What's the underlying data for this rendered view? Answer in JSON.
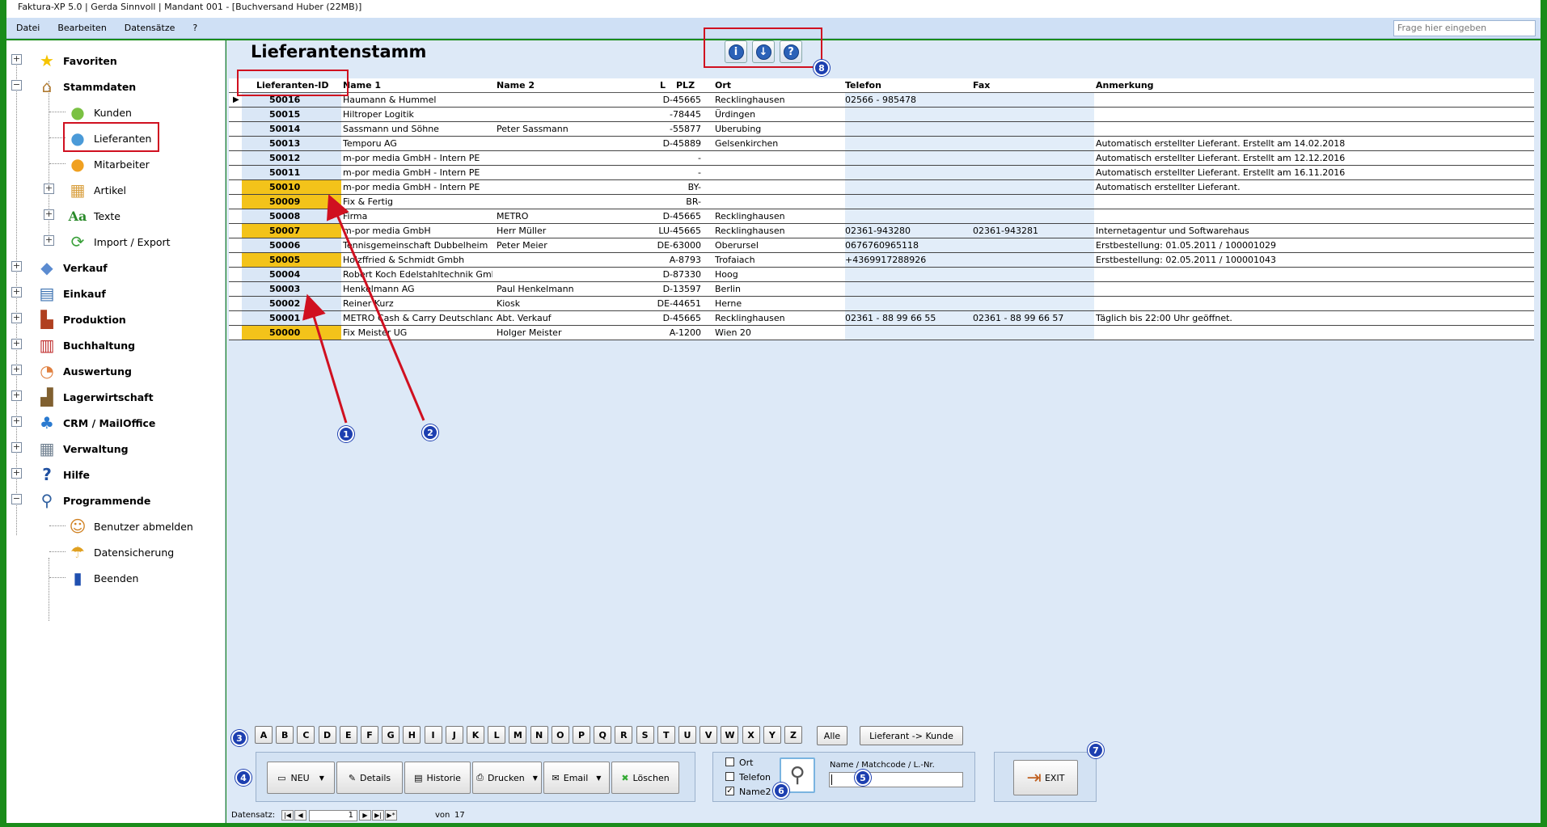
{
  "window": {
    "title": "Faktura-XP 5.0 | Gerda Sinnvoll | Mandant 001 - [Buchversand Huber (22MB)]"
  },
  "menu": {
    "items": [
      "Datei",
      "Bearbeiten",
      "Datensätze",
      "?"
    ],
    "ask_placeholder": "Frage hier eingeben"
  },
  "sidebar": {
    "items": [
      {
        "label": "Favoriten",
        "icon": "star-icon"
      },
      {
        "label": "Stammdaten",
        "icon": "house-icon"
      },
      {
        "label": "Kunden",
        "icon": "person-green-icon"
      },
      {
        "label": "Lieferanten",
        "icon": "person-blue-icon"
      },
      {
        "label": "Mitarbeiter",
        "icon": "person-orange-icon"
      },
      {
        "label": "Artikel",
        "icon": "boxes-icon"
      },
      {
        "label": "Texte",
        "icon": "text-aa-icon"
      },
      {
        "label": "Import / Export",
        "icon": "arrows-cycle-icon"
      },
      {
        "label": "Verkauf",
        "icon": "tag-icon"
      },
      {
        "label": "Einkauf",
        "icon": "basket-icon"
      },
      {
        "label": "Produktion",
        "icon": "factory-icon"
      },
      {
        "label": "Buchhaltung",
        "icon": "binders-icon"
      },
      {
        "label": "Auswertung",
        "icon": "chart-icon"
      },
      {
        "label": "Lagerwirtschaft",
        "icon": "forklift-icon"
      },
      {
        "label": "CRM / MailOffice",
        "icon": "people-icon"
      },
      {
        "label": "Verwaltung",
        "icon": "calculator-icon"
      },
      {
        "label": "Hilfe",
        "icon": "help-book-icon"
      },
      {
        "label": "Programmende",
        "icon": "key-icon"
      },
      {
        "label": "Benutzer abmelden",
        "icon": "users-icon"
      },
      {
        "label": "Datensicherung",
        "icon": "umbrella-icon"
      },
      {
        "label": "Beenden",
        "icon": "exit-door-icon"
      }
    ]
  },
  "page": {
    "title": "Lieferantenstamm"
  },
  "grid": {
    "headers": {
      "id": "Lieferanten-ID",
      "name1": "Name 1",
      "name2": "Name 2",
      "l": "L",
      "plz": "PLZ",
      "ort": "Ort",
      "telefon": "Telefon",
      "fax": "Fax",
      "anmerkung": "Anmerkung"
    },
    "rows": [
      {
        "id": "50016",
        "name1": "Haumann & Hummel",
        "name2": "",
        "plz": "D-45665",
        "ort": "Recklinghausen",
        "telefon": "02566 - 985478",
        "fax": "",
        "anmerkung": "",
        "hl": false
      },
      {
        "id": "50015",
        "name1": "Hiltroper Logitik",
        "name2": "",
        "plz": "-78445",
        "ort": "Ürdingen",
        "telefon": "",
        "fax": "",
        "anmerkung": "",
        "hl": false
      },
      {
        "id": "50014",
        "name1": "Sassmann und Söhne",
        "name2": "Peter Sassmann",
        "plz": "-55877",
        "ort": "Uberubing",
        "telefon": "",
        "fax": "",
        "anmerkung": "",
        "hl": false
      },
      {
        "id": "50013",
        "name1": "Temporu AG",
        "name2": "",
        "plz": "D-45889",
        "ort": "Gelsenkirchen",
        "telefon": "",
        "fax": "",
        "anmerkung": "Automatisch erstellter Lieferant. Erstellt am 14.02.2018",
        "hl": false
      },
      {
        "id": "50012",
        "name1": "m-por media GmbH - Intern PE",
        "name2": "",
        "plz": "-",
        "ort": "",
        "telefon": "",
        "fax": "",
        "anmerkung": "Automatisch erstellter Lieferant. Erstellt am 12.12.2016",
        "hl": false
      },
      {
        "id": "50011",
        "name1": "m-por media GmbH - Intern PE",
        "name2": "",
        "plz": "-",
        "ort": "",
        "telefon": "",
        "fax": "",
        "anmerkung": "Automatisch erstellter Lieferant. Erstellt am 16.11.2016",
        "hl": false
      },
      {
        "id": "50010",
        "name1": "m-por media GmbH - Intern PE",
        "name2": "",
        "plz": "BY-",
        "ort": "",
        "telefon": "",
        "fax": "",
        "anmerkung": "Automatisch erstellter Lieferant.",
        "hl": true
      },
      {
        "id": "50009",
        "name1": "Fix & Fertig",
        "name2": "",
        "plz": "BR-",
        "ort": "",
        "telefon": "",
        "fax": "",
        "anmerkung": "",
        "hl": true
      },
      {
        "id": "50008",
        "name1": "Firma",
        "name2": "METRO",
        "plz": "D-45665",
        "ort": "Recklinghausen",
        "telefon": "",
        "fax": "",
        "anmerkung": "",
        "hl": false
      },
      {
        "id": "50007",
        "name1": "m-por media GmbH",
        "name2": "Herr Müller",
        "plz": "LU-45665",
        "ort": "Recklinghausen",
        "telefon": "02361-943280",
        "fax": "02361-943281",
        "anmerkung": "Internetagentur und Softwarehaus",
        "hl": true
      },
      {
        "id": "50006",
        "name1": "Tennisgemeinschaft Dubbelheim",
        "name2": "Peter Meier",
        "plz": "DE-63000",
        "ort": "Oberursel",
        "telefon": "0676760965118",
        "fax": "",
        "anmerkung": "Erstbestellung: 01.05.2011 / 100001029",
        "hl": false
      },
      {
        "id": "50005",
        "name1": "Holzffried & Schmidt Gmbh",
        "name2": "",
        "plz": "A-8793",
        "ort": "Trofaiach",
        "telefon": "+4369917288926",
        "fax": "",
        "anmerkung": "Erstbestellung: 02.05.2011 / 100001043",
        "hl": true
      },
      {
        "id": "50004",
        "name1": "Robert Koch Edelstahltechnik Gmb",
        "name2": "",
        "plz": "D-87330",
        "ort": "Hoog",
        "telefon": "",
        "fax": "",
        "anmerkung": "",
        "hl": false
      },
      {
        "id": "50003",
        "name1": "Henkelmann AG",
        "name2": "Paul Henkelmann",
        "plz": "D-13597",
        "ort": "Berlin",
        "telefon": "",
        "fax": "",
        "anmerkung": "",
        "hl": false
      },
      {
        "id": "50002",
        "name1": "Reiner Kurz",
        "name2": "Kiosk",
        "plz": "DE-44651",
        "ort": "Herne",
        "telefon": "",
        "fax": "",
        "anmerkung": "",
        "hl": false
      },
      {
        "id": "50001",
        "name1": "METRO Cash & Carry Deutschland",
        "name2": "Abt. Verkauf",
        "plz": "D-45665",
        "ort": "Recklinghausen",
        "telefon": "02361 - 88 99 66 55",
        "fax": "02361 - 88 99 66 57",
        "anmerkung": "Täglich bis 22:00 Uhr geöffnet.",
        "hl": false
      },
      {
        "id": "50000",
        "name1": "Fix Meister UG",
        "name2": "Holger Meister",
        "plz": "A-1200",
        "ort": "Wien 20",
        "telefon": "",
        "fax": "",
        "anmerkung": "",
        "hl": true
      }
    ]
  },
  "alphabet": [
    "A",
    "B",
    "C",
    "D",
    "E",
    "F",
    "G",
    "H",
    "I",
    "J",
    "K",
    "L",
    "M",
    "N",
    "O",
    "P",
    "Q",
    "R",
    "S",
    "T",
    "U",
    "V",
    "W",
    "X",
    "Y",
    "Z"
  ],
  "alpha_buttons": {
    "all": "Alle",
    "convert": "Lieferant -> Kunde"
  },
  "actions": {
    "neu": "NEU",
    "details": "Details",
    "historie": "Historie",
    "drucken": "Drucken",
    "email": "Email",
    "loeschen": "Löschen"
  },
  "search": {
    "ort": "Ort",
    "telefon": "Telefon",
    "name2": "Name2",
    "label": "Name / Matchcode / L.-Nr.",
    "value": ""
  },
  "exit": {
    "label": "EXIT"
  },
  "status": {
    "label": "Datensatz:",
    "current": "1",
    "of": "von",
    "total": "17"
  },
  "badges": [
    "1",
    "2",
    "3",
    "4",
    "5",
    "6",
    "7",
    "8"
  ],
  "colors": {
    "highlight": "#f3c31a",
    "accent_red": "#d01020",
    "badge": "#1d3fb0"
  }
}
